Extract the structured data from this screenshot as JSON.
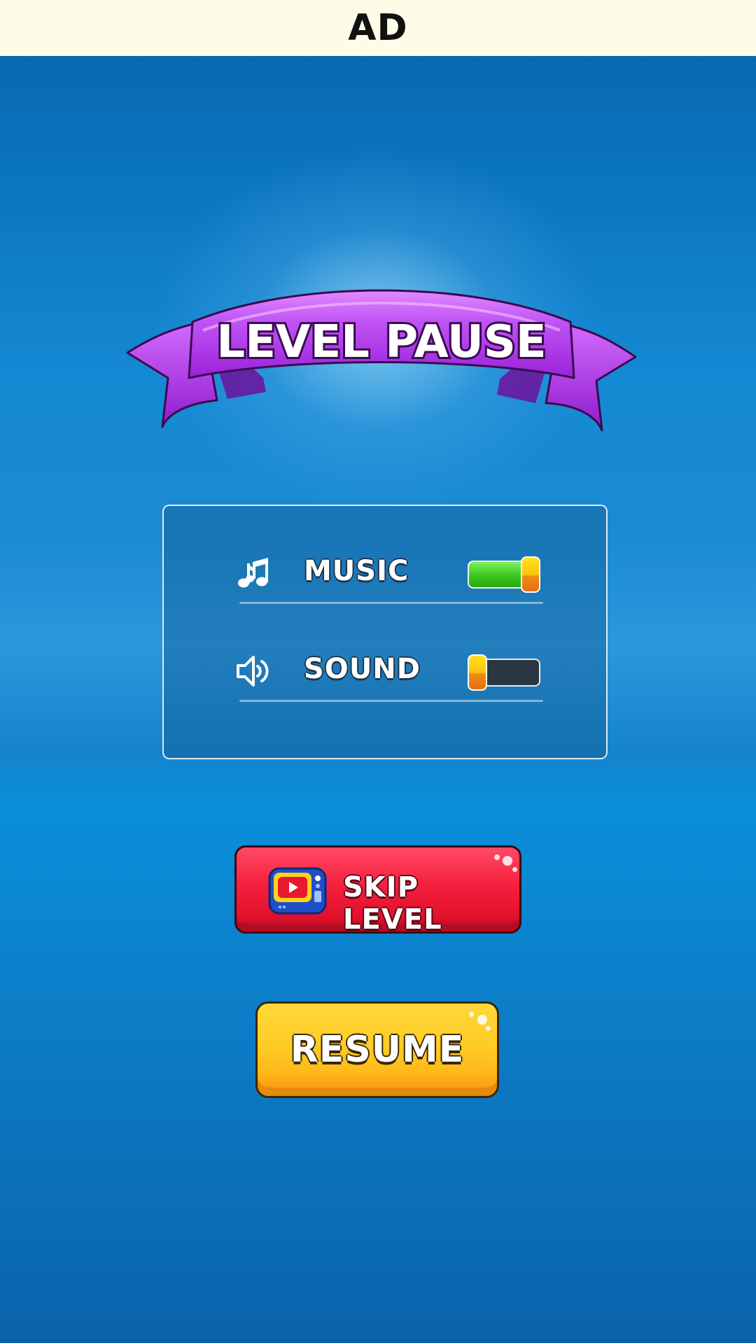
{
  "ad_bar": {
    "label": "AD"
  },
  "header": {
    "title": "LEVEL PAUSE"
  },
  "settings": {
    "music": {
      "label": "MUSIC",
      "icon": "music-note-icon",
      "enabled": true
    },
    "sound": {
      "label": "SOUND",
      "icon": "speaker-icon",
      "enabled": false
    }
  },
  "buttons": {
    "skip": {
      "label": "SKIP LEVEL",
      "icon": "video-ad-tv-icon"
    },
    "resume": {
      "label": "RESUME"
    }
  },
  "colors": {
    "ribbon": "#b23ff0",
    "toggle_on": "#36c41c",
    "toggle_off": "#2a3640",
    "knob": "#ffc20e",
    "skip_button": "#f5203e",
    "resume_button": "#ffc226",
    "background": "#0a7cc6"
  }
}
